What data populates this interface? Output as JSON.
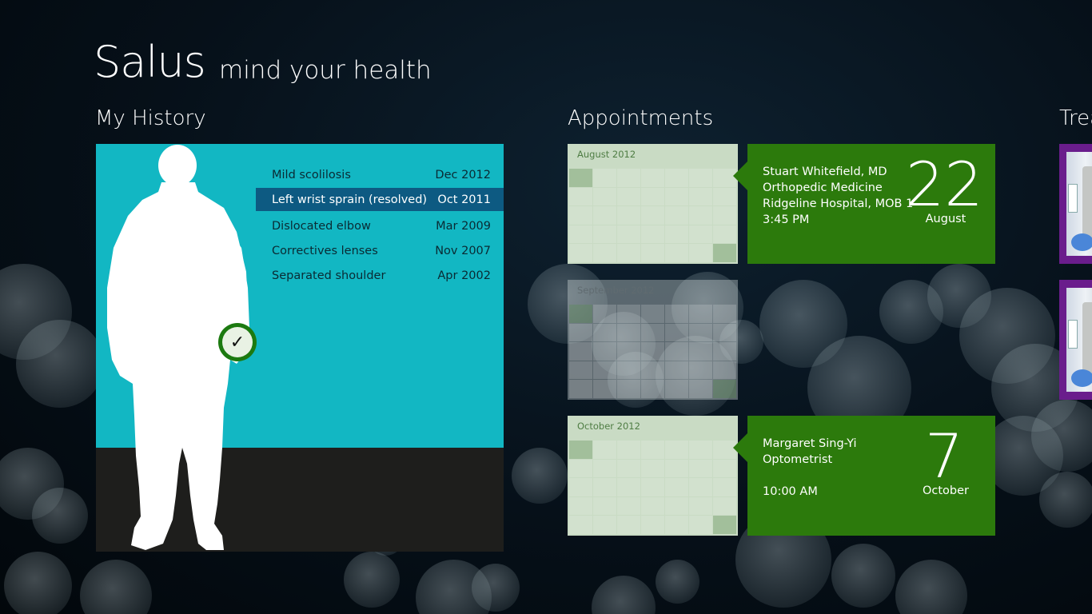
{
  "app": {
    "title": "Salus",
    "subtitle": "mind your health"
  },
  "sections": {
    "history": "My History",
    "appointments": "Appointments",
    "treatments": "Trea"
  },
  "history": {
    "items": [
      {
        "condition": "Mild scolilosis",
        "date": "Dec 2012",
        "selected": false
      },
      {
        "condition": "Left wrist sprain (resolved)",
        "date": "Oct 2011",
        "selected": true
      },
      {
        "condition": "Dislocated elbow",
        "date": "Mar 2009",
        "selected": false
      },
      {
        "condition": "Correctives lenses",
        "date": "Nov 2007",
        "selected": false
      },
      {
        "condition": "Separated shoulder",
        "date": "Apr 2002",
        "selected": false
      }
    ],
    "status_icon": "checkmark-icon"
  },
  "calendars": [
    {
      "month": "August 2012",
      "state": "active"
    },
    {
      "month": "September 2012",
      "state": "faded"
    },
    {
      "month": "October 2012",
      "state": "active"
    }
  ],
  "appointments": [
    {
      "doctor": "Stuart Whitefield, MD",
      "specialty": "Orthopedic Medicine",
      "location": "Ridgeline Hospital, MOB 1",
      "time": "3:45 PM",
      "day": "22",
      "month": "August"
    },
    {
      "doctor": "Margaret Sing-Yi",
      "specialty": "Optometrist",
      "location": "",
      "time": "10:00 AM",
      "day": "7",
      "month": "October"
    }
  ],
  "colors": {
    "history_tile": "#12b7c3",
    "selected_row": "#0d5a82",
    "appointment_tile": "#2c7a0c",
    "treatment_tile": "#6a1d8c",
    "calendar": "#c9dbc4"
  }
}
